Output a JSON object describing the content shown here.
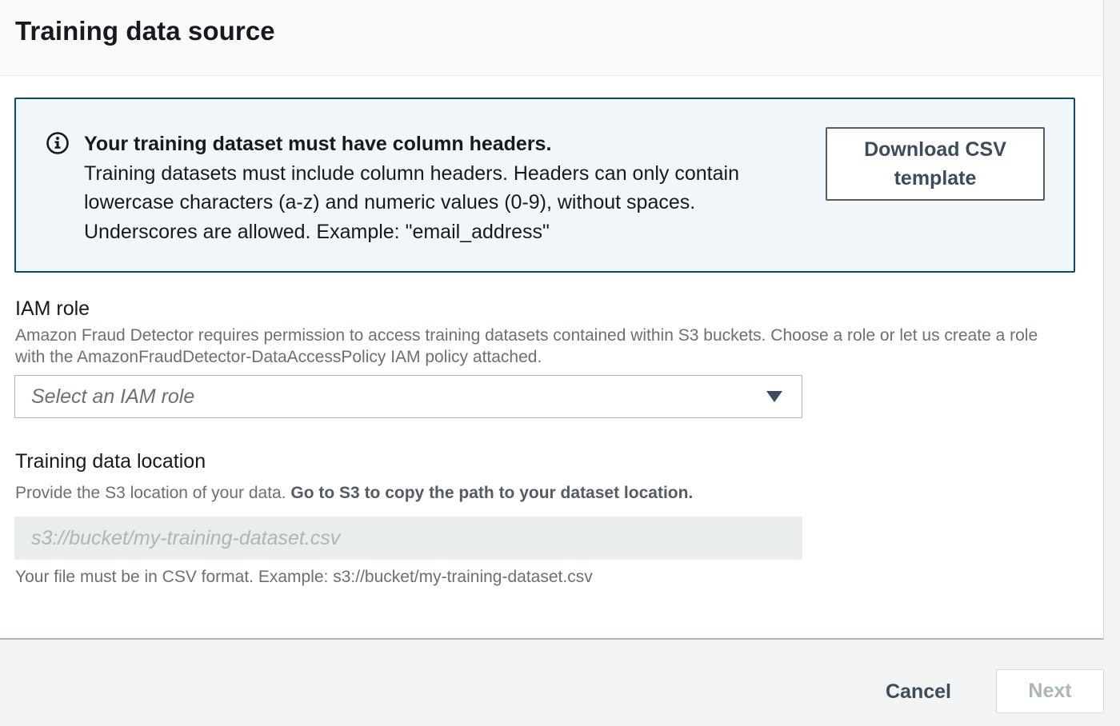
{
  "panel": {
    "title": "Training data source"
  },
  "info_alert": {
    "heading": "Your training dataset must have column headers.",
    "body": "Training datasets must include column headers. Headers can only contain lowercase characters (a-z) and numeric values (0-9), without spaces. Underscores are allowed. Example: \"email_address\"",
    "icon": "info-icon",
    "download_button_label": "Download CSV template"
  },
  "iam_role": {
    "label": "IAM role",
    "description": "Amazon Fraud Detector requires permission to access training datasets contained within S3 buckets. Choose a role or let us create a role with the AmazonFraudDetector-DataAccessPolicy IAM policy attached.",
    "select_placeholder": "Select an IAM role",
    "caret_icon": "caret-down-icon"
  },
  "training_data_location": {
    "label": "Training data location",
    "description": "Provide the S3 location of your data.",
    "description_strong": "Go to S3 to copy the path to your dataset location.",
    "input_placeholder": "s3://bucket/my-training-dataset.csv",
    "input_value": "",
    "constraint": "Your file must be in CSV format. Example: s3://bucket/my-training-dataset.csv"
  },
  "footer": {
    "cancel_label": "Cancel",
    "next_label": "Next"
  },
  "colors": {
    "info_border": "#0b4a6a",
    "info_background": "#f1f6fa",
    "button_text": "#3b4c5c",
    "muted_text": "#687078",
    "disabled_text": "#aab7b8"
  }
}
